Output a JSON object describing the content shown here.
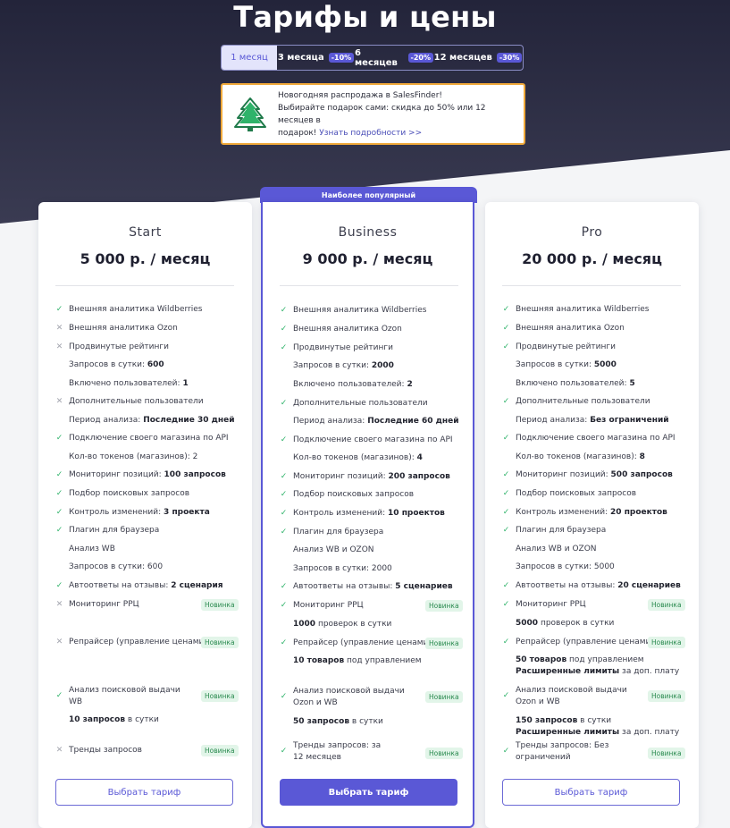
{
  "page": {
    "title": "Тарифы и цены"
  },
  "periods": [
    {
      "label": "1 месяц",
      "discount": ""
    },
    {
      "label": "3 месяца",
      "discount": "-10%"
    },
    {
      "label": "6 месяцев",
      "discount": "-20%"
    },
    {
      "label": "12 месяцев",
      "discount": "-30%"
    }
  ],
  "promo": {
    "line1": "Новогодняя распродажа в SalesFinder!",
    "line2": "Выбирайте подарок сами: скидка до 50% или 12 месяцев в",
    "line3_prefix": "подарок!",
    "link": "Узнать подробности >>"
  },
  "popular_label": "Наиболее популярный",
  "badge_new": "Новинка",
  "plans": [
    {
      "name": "Start",
      "price": "5 000 р. / месяц",
      "button": "Выбрать тариф",
      "features": [
        {
          "mark": "check",
          "text": "Внешняя аналитика Wildberries"
        },
        {
          "mark": "cross",
          "text": "Внешняя аналитика Ozon"
        },
        {
          "mark": "cross",
          "text": "Продвинутые рейтинги"
        },
        {
          "mark": "none",
          "text": "Запросов в сутки:",
          "bold": "600"
        },
        {
          "mark": "none",
          "text": "Включено пользователей:",
          "bold": "1"
        },
        {
          "mark": "cross",
          "text": "Дополнительные пользователи"
        },
        {
          "mark": "none",
          "text": "Период анализа:",
          "bold": "Последние 30 дней"
        },
        {
          "mark": "check",
          "text": "Подключение своего магазина по API"
        },
        {
          "mark": "none",
          "text": "Кол-во токенов (магазинов): 2"
        },
        {
          "mark": "check",
          "text": "Мониторинг позиций:",
          "bold": "100 запросов"
        },
        {
          "mark": "check",
          "text": "Подбор поисковых запросов"
        },
        {
          "mark": "check",
          "text": "Контроль изменений:",
          "bold": "3 проекта"
        },
        {
          "mark": "check",
          "text": "Плагин для браузера"
        },
        {
          "mark": "none",
          "text": "Анализ WB"
        },
        {
          "mark": "none",
          "text": "Запросов в сутки: 600"
        },
        {
          "mark": "check",
          "text": "Автоответы на отзывы:",
          "bold": "2 сценария"
        },
        {
          "mark": "cross",
          "text": "Мониторинг РРЦ",
          "badge": true
        },
        {
          "mark": "cross",
          "text": "Репрайсер (управление ценами)",
          "badge": true
        },
        {
          "mark": "check",
          "text": "Анализ поисковой выдачи",
          "text2": "WB",
          "badge": true
        },
        {
          "mark": "none",
          "bold": "10 запросов",
          "text": "в сутки"
        },
        {
          "mark": "cross",
          "text": "Тренды запросов",
          "badge": true
        }
      ]
    },
    {
      "name": "Business",
      "price": "9 000 р. / месяц",
      "button": "Выбрать тариф",
      "features": [
        {
          "mark": "check",
          "text": "Внешняя аналитика Wildberries"
        },
        {
          "mark": "check",
          "text": "Внешняя аналитика Ozon"
        },
        {
          "mark": "check",
          "text": "Продвинутые рейтинги"
        },
        {
          "mark": "none",
          "text": "Запросов в сутки:",
          "bold": "2000"
        },
        {
          "mark": "none",
          "text": "Включено пользователей:",
          "bold": "2"
        },
        {
          "mark": "check",
          "text": "Дополнительные пользователи"
        },
        {
          "mark": "none",
          "text": "Период анализа:",
          "bold": "Последние 60 дней"
        },
        {
          "mark": "check",
          "text": "Подключение своего магазина по API"
        },
        {
          "mark": "none",
          "text": "Кол-во токенов (магазинов):",
          "bold": "4"
        },
        {
          "mark": "check",
          "text": "Мониторинг позиций:",
          "bold": "200 запросов"
        },
        {
          "mark": "check",
          "text": "Подбор поисковых запросов"
        },
        {
          "mark": "check",
          "text": "Контроль изменений:",
          "bold": "10 проектов"
        },
        {
          "mark": "check",
          "text": "Плагин для браузера"
        },
        {
          "mark": "none",
          "text": "Анализ WB и OZON"
        },
        {
          "mark": "none",
          "text": "Запросов в сутки: 2000"
        },
        {
          "mark": "check",
          "text": "Автоответы на отзывы:",
          "bold": "5 сценариев"
        },
        {
          "mark": "check",
          "text": "Мониторинг РРЦ",
          "badge": true
        },
        {
          "mark": "none",
          "bold": "1000",
          "text": "проверок в сутки"
        },
        {
          "mark": "check",
          "text": "Репрайсер (управление ценами)",
          "badge": true
        },
        {
          "mark": "none",
          "bold": "10 товаров",
          "text": "под управлением"
        },
        {
          "mark": "check",
          "text": "Анализ поисковой выдачи",
          "text2": "Ozon и WB",
          "badge": true
        },
        {
          "mark": "none",
          "bold": "50 запросов",
          "text": "в сутки"
        },
        {
          "mark": "check",
          "text": "Тренды запросов: за",
          "text2": "12 месяцев",
          "badge": true
        }
      ]
    },
    {
      "name": "Pro",
      "price": "20 000 р. / месяц",
      "button": "Выбрать тариф",
      "features": [
        {
          "mark": "check",
          "text": "Внешняя аналитика Wildberries"
        },
        {
          "mark": "check",
          "text": "Внешняя аналитика Ozon"
        },
        {
          "mark": "check",
          "text": "Продвинутые рейтинги"
        },
        {
          "mark": "none",
          "text": "Запросов в сутки:",
          "bold": "5000"
        },
        {
          "mark": "none",
          "text": "Включено пользователей:",
          "bold": "5"
        },
        {
          "mark": "check",
          "text": "Дополнительные пользователи"
        },
        {
          "mark": "none",
          "text": "Период анализа:",
          "bold": "Без ограничений"
        },
        {
          "mark": "check",
          "text": "Подключение своего магазина по API"
        },
        {
          "mark": "none",
          "text": "Кол-во токенов (магазинов):",
          "bold": "8"
        },
        {
          "mark": "check",
          "text": "Мониторинг позиций:",
          "bold": "500 запросов"
        },
        {
          "mark": "check",
          "text": "Подбор поисковых запросов"
        },
        {
          "mark": "check",
          "text": "Контроль изменений:",
          "bold": "20 проектов"
        },
        {
          "mark": "check",
          "text": "Плагин для браузера"
        },
        {
          "mark": "none",
          "text": "Анализ WB и OZON"
        },
        {
          "mark": "none",
          "text": "Запросов в сутки: 5000"
        },
        {
          "mark": "check",
          "text": "Автоответы на отзывы:",
          "bold": "20 сценариев"
        },
        {
          "mark": "check",
          "text": "Мониторинг РРЦ",
          "badge": true
        },
        {
          "mark": "none",
          "bold": "5000",
          "text": "проверок в сутки"
        },
        {
          "mark": "check",
          "text": "Репрайсер (управление ценами)",
          "badge": true
        },
        {
          "mark": "none",
          "bold": "50 товаров",
          "text": "под управлением",
          "bold2": "Расширенные лимиты",
          "text2": "за доп. плату"
        },
        {
          "mark": "check",
          "text": "Анализ поисковой выдачи",
          "text2": "Ozon и WB",
          "badge": true
        },
        {
          "mark": "none",
          "bold": "150 запросов",
          "text": "в сутки",
          "bold2": "Расширенные лимиты",
          "text2": "за доп. плату"
        },
        {
          "mark": "check",
          "text": "Тренды запросов: Без",
          "text2": "ограничений",
          "badge": true
        }
      ]
    }
  ]
}
